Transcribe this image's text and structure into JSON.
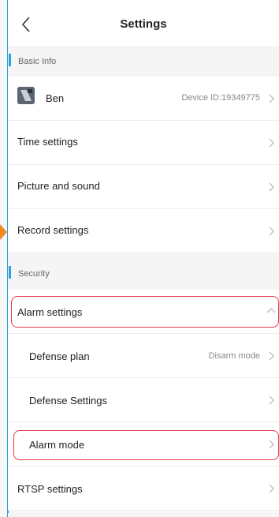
{
  "header": {
    "title": "Settings"
  },
  "basic_info": {
    "label": "Basic Info",
    "device": {
      "name": "Ben",
      "device_id": "Device ID:19349775"
    },
    "items": [
      "Time settings",
      "Picture and sound",
      "Record settings"
    ]
  },
  "security": {
    "label": "Security",
    "alarm_settings": {
      "label": "Alarm settings",
      "expanded": true
    },
    "sub_items": [
      {
        "label": "Defense plan",
        "value": "Disarm mode"
      },
      {
        "label": "Defense Settings"
      },
      {
        "label": "Alarm mode"
      }
    ],
    "rtsp": {
      "label": "RTSP settings"
    }
  },
  "icons": {
    "back": "chevron-left-icon",
    "row_arrow": "chevron-right-icon",
    "expand": "chevron-up-icon"
  },
  "colors": {
    "accent": "#2aa3e0",
    "highlight": "#e03a4a",
    "marker": "#f08a24"
  }
}
